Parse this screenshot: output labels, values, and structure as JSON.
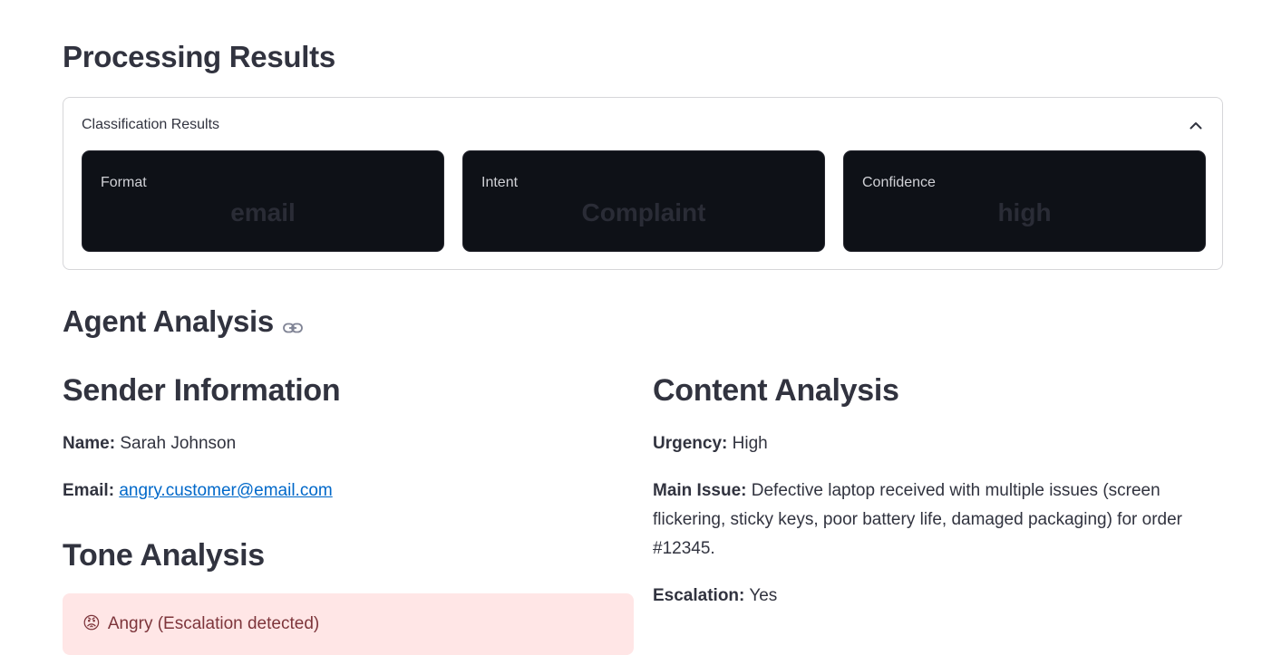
{
  "page": {
    "title": "Processing Results"
  },
  "classification": {
    "expander_title": "Classification Results",
    "metrics": [
      {
        "label": "Format",
        "value": "email"
      },
      {
        "label": "Intent",
        "value": "Complaint"
      },
      {
        "label": "Confidence",
        "value": "high"
      }
    ]
  },
  "agent_analysis": {
    "heading": "Agent Analysis",
    "anchor_icon": "link-icon"
  },
  "sender": {
    "heading": "Sender Information",
    "name_label": "Name:",
    "name_value": "Sarah Johnson",
    "email_label": "Email:",
    "email_value": "angry.customer@email.com"
  },
  "tone": {
    "heading": "Tone Analysis",
    "alert_emoji": "😡",
    "alert_text": "Angry (Escalation detected)"
  },
  "content": {
    "heading": "Content Analysis",
    "urgency_label": "Urgency:",
    "urgency_value": "High",
    "issue_label": "Main Issue:",
    "issue_value": "Defective laptop received with multiple issues (screen flickering, sticky keys, poor battery life, damaged packaging) for order #12345.",
    "escalation_label": "Escalation:",
    "escalation_value": "Yes"
  },
  "colors": {
    "alert_bg": "#ffe6e6",
    "alert_text": "#7d353b",
    "metric_bg": "#0e1117",
    "link": "#0068c9"
  }
}
